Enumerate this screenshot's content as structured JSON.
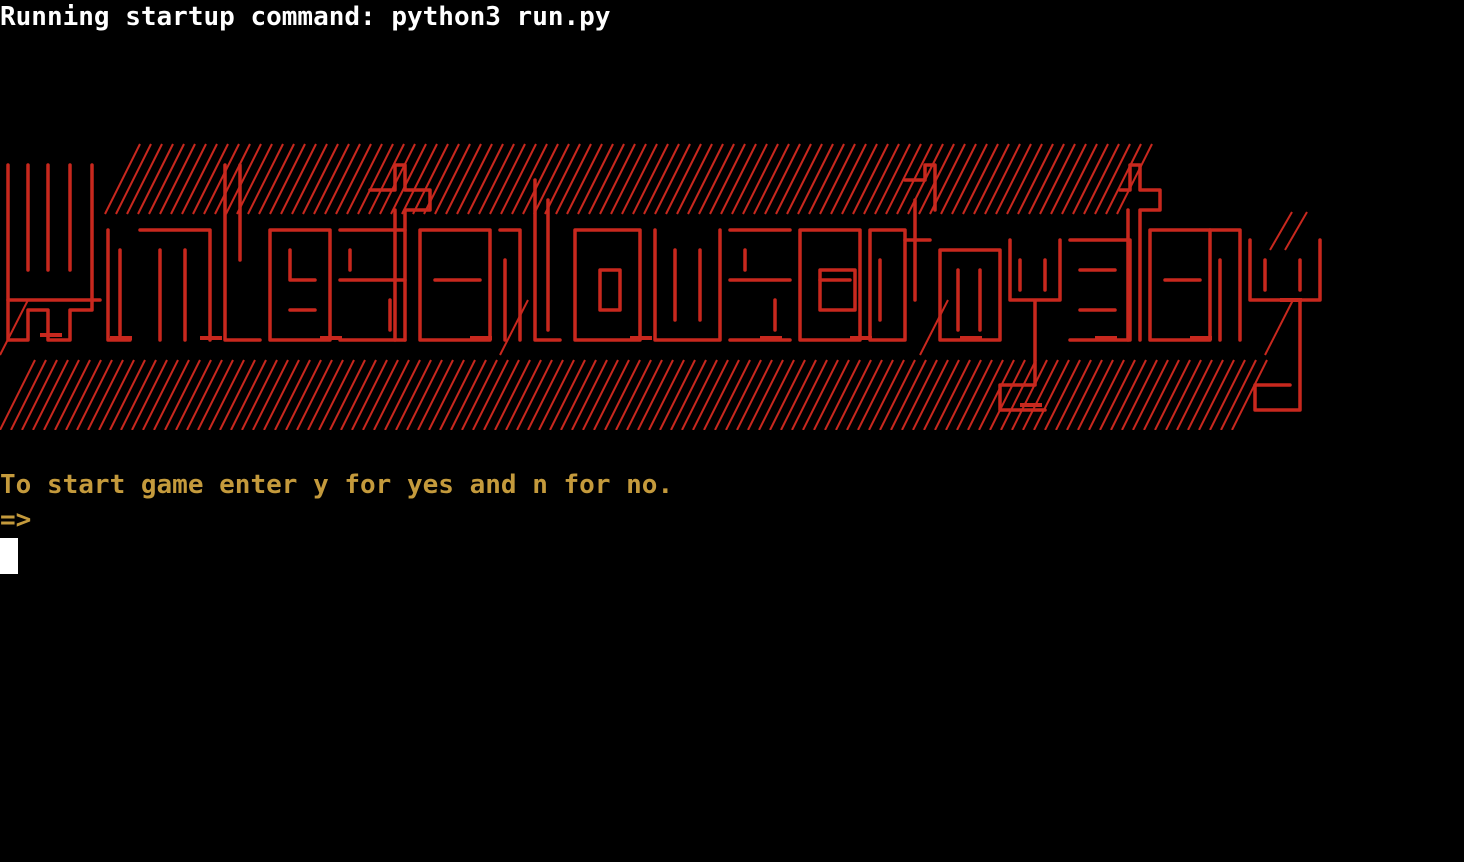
{
  "terminal": {
    "startup_line": "Running startup command: python3 run.py",
    "prompt_line": "To start game enter y for yes and n for no.",
    "input_prefix": "=>",
    "input_value": ""
  },
  "banner": {
    "text": "Winchester House of Mystery",
    "style": "ascii-art",
    "color": "#c8281e"
  },
  "colors": {
    "background": "#000000",
    "startup_text": "#ffffff",
    "prompt_text": "#c49a3c",
    "cursor": "#ffffff"
  }
}
